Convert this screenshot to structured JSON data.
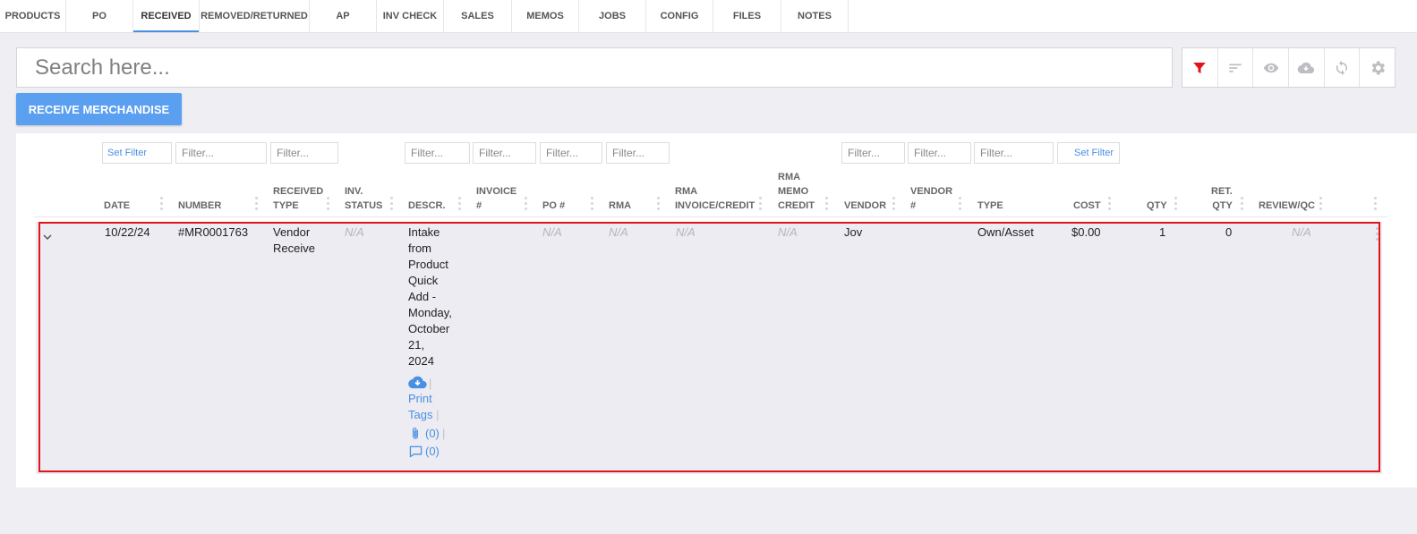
{
  "tabs": [
    "PRODUCTS",
    "PO",
    "RECEIVED",
    "REMOVED/RETURNED",
    "AP",
    "INV CHECK",
    "SALES",
    "MEMOS",
    "JOBS",
    "CONFIG",
    "FILES",
    "NOTES"
  ],
  "active_tab": "RECEIVED",
  "search": {
    "placeholder": "Search here..."
  },
  "toolbar": {
    "icons": [
      "filter-icon",
      "sort-icon",
      "eye-icon",
      "cloud-download-icon",
      "refresh-icon",
      "gear-icon"
    ],
    "filter_active_color": "#e3131c",
    "icon_color": "#bdbdc2"
  },
  "receive_button": "RECEIVE MERCHANDISE",
  "filters": {
    "set_filter_label": "Set Filter",
    "placeholder": "Filter..."
  },
  "columns": {
    "date": "DATE",
    "number": "NUMBER",
    "received_type": [
      "RECEIVED",
      "TYPE"
    ],
    "inv_status": [
      "INV.",
      "STATUS"
    ],
    "descr": "DESCR.",
    "invoice": [
      "INVOICE",
      "#"
    ],
    "po": "PO #",
    "rma": "RMA",
    "rma_invoice": [
      "RMA",
      "INVOICE/CREDIT"
    ],
    "rma_memo": [
      "RMA",
      "MEMO",
      "CREDIT"
    ],
    "vendor": "VENDOR",
    "vendor_num": [
      "VENDOR",
      "#"
    ],
    "type": "TYPE",
    "cost": "COST",
    "qty": "QTY",
    "ret_qty": [
      "RET.",
      "QTY"
    ],
    "review": "REVIEW/QC"
  },
  "row": {
    "date": "10/22/24",
    "number": "#MR0001763",
    "received_type": [
      "Vendor",
      "Receive"
    ],
    "inv_status": "N/A",
    "descr": [
      "Intake",
      "from",
      "Product",
      "Quick",
      "Add -",
      "Monday,",
      "October",
      "21,",
      "2024"
    ],
    "po": "N/A",
    "rma": "N/A",
    "rma_invoice": "N/A",
    "rma_memo": "N/A",
    "vendor": "Jov",
    "type": "Own/Asset",
    "cost": "$0.00",
    "qty": "1",
    "ret_qty": "0",
    "review": "N/A",
    "actions": {
      "print_tags": [
        "Print",
        "Tags"
      ],
      "attachments_count": "(0)",
      "comments_count": "(0)",
      "separator": "|"
    }
  }
}
